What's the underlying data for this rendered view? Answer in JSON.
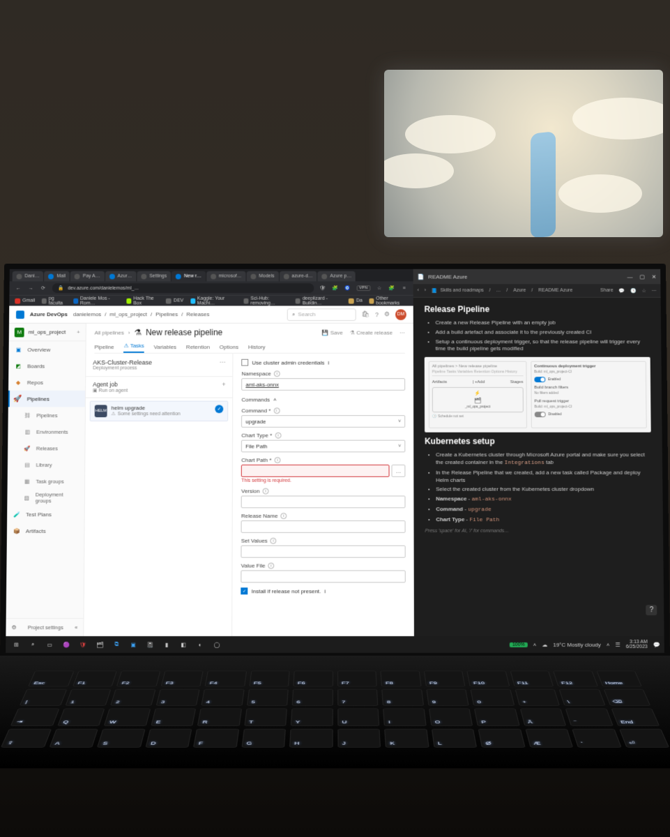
{
  "browser": {
    "tabs": [
      "Dani…",
      "Mail",
      "Pay A…",
      "Azur…",
      "Settings",
      "New r…",
      "microsof…",
      "Models",
      "azure-d…",
      "Azure p…"
    ],
    "active_tab_index": 5,
    "url_display": "dev.azure.com/danielemos/ml_…",
    "vpn_badge": "VPN",
    "bookmarks": [
      "Gmail",
      "pg faculta",
      "Daniele Mos - Rom…",
      "Hack The Box",
      "DEV",
      "Kaggle: Your Machi…",
      "Sci-Hub: removing…",
      "deeplizard - Buildin…",
      "Da",
      "Other bookmarks"
    ]
  },
  "ado": {
    "product": "Azure DevOps",
    "breadcrumb": [
      "danielemos",
      "ml_ops_project",
      "Pipelines",
      "Releases"
    ],
    "search_placeholder": "Search",
    "avatar_initials": "DM",
    "project_name": "ml_ops_project",
    "project_initial": "M",
    "sidebar": [
      {
        "label": "Overview",
        "icon": "overview",
        "color": "i-blue"
      },
      {
        "label": "Boards",
        "icon": "boards",
        "color": "i-green"
      },
      {
        "label": "Repos",
        "icon": "repos",
        "color": "i-orange"
      },
      {
        "label": "Pipelines",
        "icon": "pipelines",
        "color": "i-blue",
        "active": true
      },
      {
        "label": "Pipelines",
        "sub": true
      },
      {
        "label": "Environments",
        "sub": true
      },
      {
        "label": "Releases",
        "sub": true
      },
      {
        "label": "Library",
        "sub": true
      },
      {
        "label": "Task groups",
        "sub": true
      },
      {
        "label": "Deployment groups",
        "sub": true
      },
      {
        "label": "Test Plans",
        "icon": "test",
        "color": "i-teal"
      },
      {
        "label": "Artifacts",
        "icon": "artifacts",
        "color": "i-plum"
      }
    ],
    "footer": {
      "label": "Project settings"
    },
    "page": {
      "crumb_root": "All pipelines",
      "title": "New release pipeline",
      "save_label": "Save",
      "create_label": "Create release",
      "tabs": [
        "Pipeline",
        "Tasks",
        "Variables",
        "Retention",
        "Options",
        "History"
      ],
      "active_tab": 1,
      "stage": {
        "name": "AKS-Cluster-Release",
        "desc": "Deployment process"
      },
      "agent": {
        "name": "Agent job",
        "desc": "Run on agent"
      },
      "task": {
        "name": "helm upgrade",
        "warn": "Some settings need attention",
        "icon_text": "HELM"
      }
    },
    "form": {
      "use_admin": {
        "label": "Use cluster admin credentials",
        "checked": false
      },
      "namespace": {
        "label": "Namespace",
        "value": "aml-aks-onnx"
      },
      "commands_header": "Commands",
      "command": {
        "label": "Command *",
        "value": "upgrade"
      },
      "chart_type": {
        "label": "Chart Type *",
        "value": "File Path"
      },
      "chart_path": {
        "label": "Chart Path *",
        "value": "",
        "error": "This setting is required."
      },
      "version": {
        "label": "Version",
        "value": ""
      },
      "release_name": {
        "label": "Release Name",
        "value": ""
      },
      "set_values": {
        "label": "Set Values",
        "value": ""
      },
      "value_file": {
        "label": "Value File",
        "value": ""
      },
      "install_if_absent": {
        "label": "Install if release not present.",
        "checked": true
      }
    }
  },
  "notes_window": {
    "title": "README Azure",
    "crumbs": [
      "Skills and roadmaps",
      "…",
      "Azure",
      "README Azure"
    ],
    "toolbar": [
      "Share",
      "…",
      "☆",
      "…"
    ],
    "section1": {
      "heading": "Release Pipeline",
      "bullets": [
        "Create a new Release Pipeline with an empty job",
        "Add a build artefact and associate it to the previously created CI",
        "Setup a continuous deployment trigger, so that the release pipeline will trigger every time the build pipeline gets modified"
      ]
    },
    "diagram": {
      "crumb": "All pipelines > New release pipeline",
      "tabs": "Pipeline   Tasks   Variables   Retention   Options   History",
      "artifacts_label": "Artifacts",
      "add_label": "Add",
      "stages_label": "Stages",
      "artifact_name": "_ml_ops_project",
      "schedule": "Schedule not set",
      "cdt_title": "Continuous deployment trigger",
      "cdt_sub": "Build: ml_ops_project-CI",
      "enabled_label": "Enabled",
      "bbf_label": "Build branch filters",
      "bbf_sub": "No filters added",
      "prt_label": "Pull request trigger",
      "prt_sub": "Build: ml_ops_project-CI",
      "disabled_label": "Disabled"
    },
    "section2": {
      "heading": "Kubernetes setup",
      "bullets": [
        {
          "text": "Create a Kubernetes cluster through Microsoft Azure portal and make sure you select the created container in the",
          "code": "Integrations",
          "tail": "tab"
        },
        {
          "text": "In the Release Pipeline that we created, add a new task called Package and deploy Helm charts"
        },
        {
          "text": "Select the created cluster from the Kubernetes cluster dropdown"
        },
        {
          "bold": "Namespace",
          "sep": " - ",
          "code": "aml-aks-onnx"
        },
        {
          "bold": "Command",
          "sep": " - ",
          "code": "upgrade"
        },
        {
          "bold": "Chart Type",
          "sep": " - ",
          "code": "File Path"
        }
      ],
      "hint": "Press 'space' for AI, '/' for commands…"
    }
  },
  "taskbar": {
    "apps": [
      "win",
      "search",
      "task",
      "discord",
      "brave",
      "steam",
      "vscode",
      "notion",
      "terminal",
      "explorer",
      "settings",
      "github"
    ],
    "battery": "100%",
    "weather": "19°C  Mostly cloudy",
    "time": "3:13 AM",
    "date": "6/25/2023"
  },
  "tv_subtitle": ""
}
